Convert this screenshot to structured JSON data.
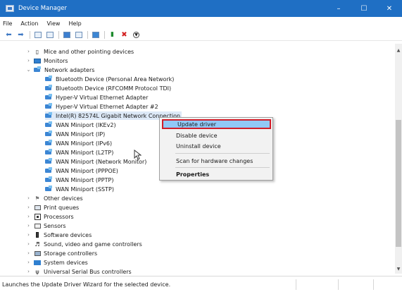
{
  "window": {
    "title": "Device Manager",
    "controls": {
      "minimize": "–",
      "maximize": "☐",
      "close": "✕"
    }
  },
  "menu": [
    "File",
    "Action",
    "View",
    "Help"
  ],
  "toolbar": {
    "back_icon": "back-arrow-icon",
    "forward_icon": "forward-arrow-icon"
  },
  "tree": {
    "categories_top": [
      {
        "label": "Mice and other pointing devices",
        "icon": "mouse-icon",
        "expanded": false
      },
      {
        "label": "Monitors",
        "icon": "monitor-icon",
        "expanded": false
      },
      {
        "label": "Network adapters",
        "icon": "network-adapter-icon",
        "expanded": true
      }
    ],
    "network_adapters": [
      "Bluetooth Device (Personal Area Network)",
      "Bluetooth Device (RFCOMM Protocol TDI)",
      "Hyper-V Virtual Ethernet Adapter",
      "Hyper-V Virtual Ethernet Adapter #2",
      "Intel(R) 82574L Gigabit Network Connection",
      "WAN Miniport (IKEv2)",
      "WAN Miniport (IP)",
      "WAN Miniport (IPv6)",
      "WAN Miniport (L2TP)",
      "WAN Miniport (Network Monitor)",
      "WAN Miniport (PPPOE)",
      "WAN Miniport (PPTP)",
      "WAN Miniport (SSTP)"
    ],
    "categories_bottom": [
      "Other devices",
      "Print queues",
      "Processors",
      "Sensors",
      "Software devices",
      "Sound, video and game controllers",
      "Storage controllers",
      "System devices",
      "Universal Serial Bus controllers"
    ]
  },
  "context_menu": {
    "update_driver": "Update driver",
    "disable_device": "Disable device",
    "uninstall_device": "Uninstall device",
    "scan_hardware": "Scan for hardware changes",
    "properties": "Properties"
  },
  "status": "Launches the Update Driver Wizard for the selected device.",
  "colors": {
    "titlebar": "#1f6fc4",
    "highlight": "#91c9f7",
    "highlight_border": "#d11d2a"
  }
}
